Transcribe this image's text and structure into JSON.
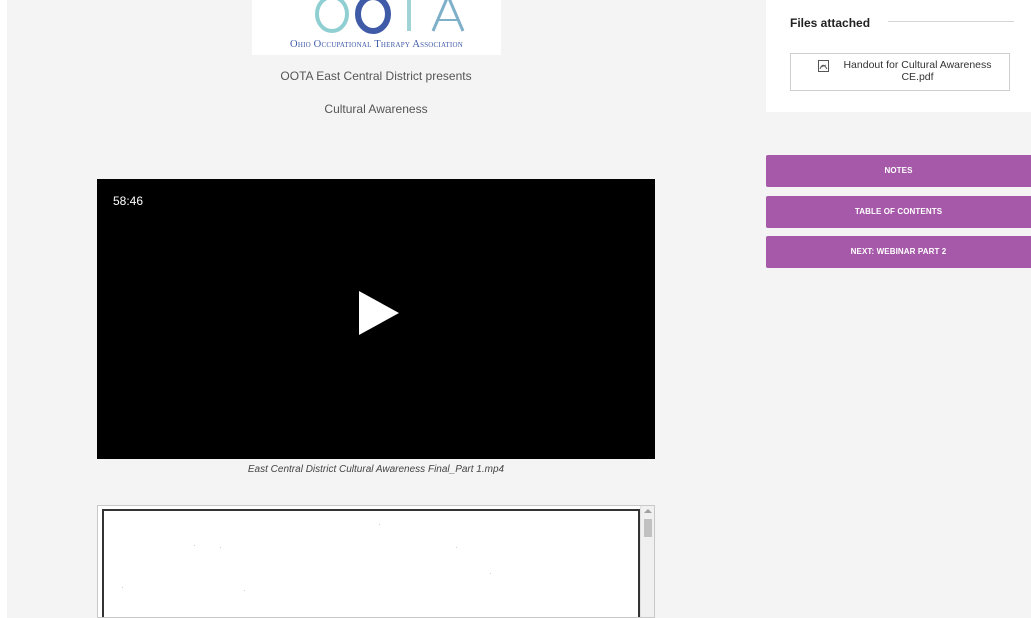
{
  "logo": {
    "letters": "OOTA",
    "org_name": "Ohio Occupational Therapy Association"
  },
  "main": {
    "presents": "OOTA East Central District presents",
    "course_title": "Cultural Awareness",
    "video": {
      "time": "58:46",
      "caption": "East Central District Cultural Awareness Final_Part 1.mp4"
    }
  },
  "sidebar": {
    "files_heading": "Files attached",
    "file": {
      "icon": "pdf-icon",
      "label": "Handout for Cultural Awareness CE.pdf"
    },
    "buttons": {
      "notes": "NOTES",
      "toc": "TABLE OF CONTENTS",
      "next": "NEXT: WEBINAR PART 2"
    }
  },
  "colors": {
    "accent_purple": "#a559a8",
    "logo_blue": "#3f5aa7",
    "logo_teal": "#7fc4c8",
    "page_bg": "#f4f4f4"
  }
}
